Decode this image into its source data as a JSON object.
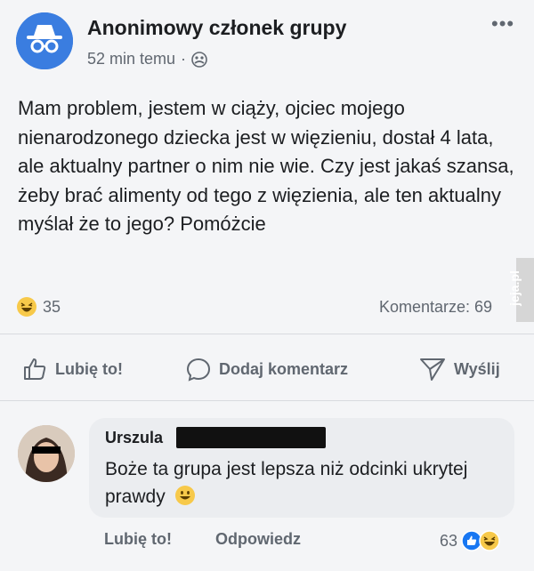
{
  "post": {
    "author": "Anonimowy członek grupy",
    "time": "52 min temu",
    "separator": "·",
    "text": "Mam problem, jestem w ciąży, ojciec mojego nienarodzonego dziecka jest w więzieniu, dostał 4 lata, ale aktualny partner o nim nie wie. Czy jest jakaś szansa, żeby brać alimenty od tego z więzienia, ale ten aktualny myślał że to jego? Pomóżcie",
    "more_label": "•••",
    "reactions_count": "35",
    "comments_label": "Komentarze: 69"
  },
  "actions": {
    "like": "Lubię to!",
    "comment": "Dodaj komentarz",
    "send": "Wyślij"
  },
  "comment": {
    "author": "Urszula",
    "text": "Boże ta grupa jest lepsza niż odcinki ukrytej prawdy",
    "like": "Lubię to!",
    "reply": "Odpowiedz",
    "reactions_count": "63"
  },
  "watermark": "jeja.pl",
  "colors": {
    "anon_avatar": "#3a7de0",
    "like_blue": "#1877f2",
    "haha_yellow": "#f7c94a",
    "watermark_red": "#e02828"
  },
  "icons": [
    "incognito-icon",
    "group-icon",
    "laugh-emoji-icon",
    "like-icon",
    "comment-icon",
    "send-icon",
    "smile-emoji-icon"
  ]
}
